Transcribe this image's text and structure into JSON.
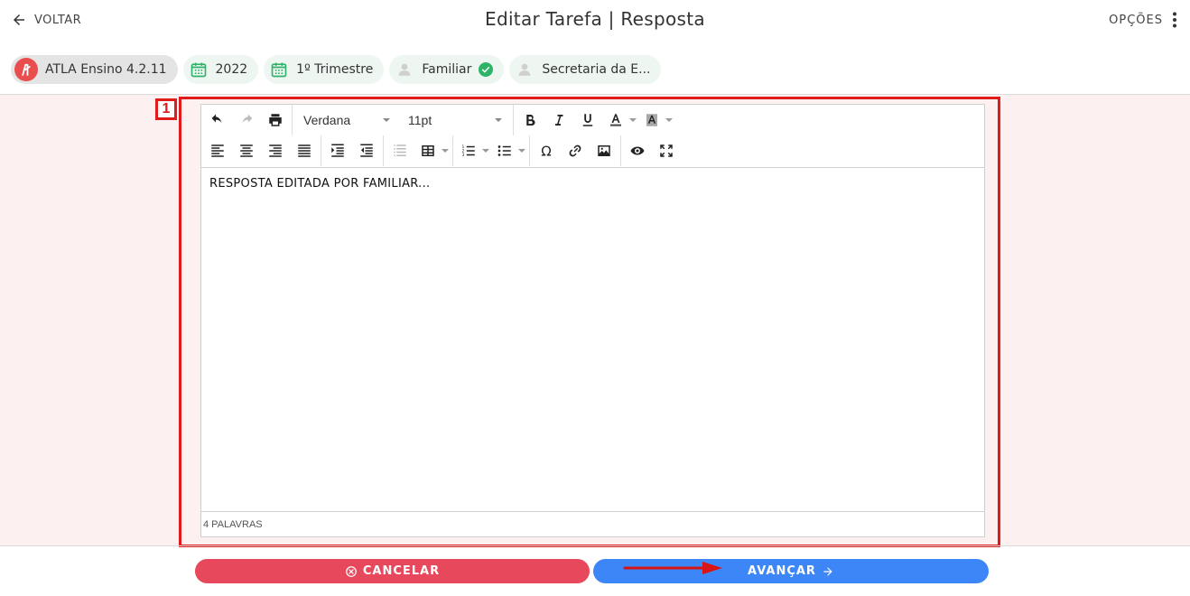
{
  "header": {
    "back_label": "VOLTAR",
    "title": "Editar Tarefa | Resposta",
    "options_label": "OPÇÕES"
  },
  "chips": {
    "app": "ATLA Ensino 4.2.11",
    "year": "2022",
    "period": "1º Trimestre",
    "role": "Familiar",
    "secretaria": "Secretaria da E..."
  },
  "annotation": {
    "step_number": "1"
  },
  "editor": {
    "font_family": "Verdana",
    "font_size": "11pt",
    "content": "RESPOSTA EDITADA POR FAMILIAR...",
    "word_count": "4 PALAVRAS"
  },
  "actions": {
    "cancel_label": "CANCELAR",
    "next_label": "AVANÇAR"
  },
  "colors": {
    "highlight": "#e01b1b",
    "cancel": "#e8485c",
    "next": "#3d86f8",
    "success": "#2fb368",
    "content_bg": "#fdf0f0"
  }
}
